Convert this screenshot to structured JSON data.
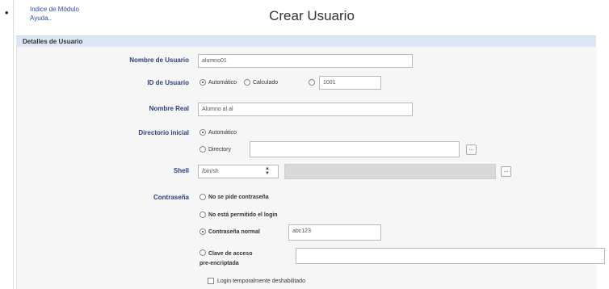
{
  "header": {
    "module_index_link": "Indice de Módulo",
    "help_link": "Ayuda..",
    "title": "Crear Usuario"
  },
  "section": {
    "title": "Detalles de Usuario"
  },
  "form": {
    "username": {
      "label": "Nombre de Usuario",
      "value": "alumno01"
    },
    "user_id": {
      "label": "ID de Usuario",
      "options": [
        "Automático",
        "Calculado",
        ""
      ],
      "selected": "Automático",
      "value": "1001"
    },
    "real_name": {
      "label": "Nombre Real",
      "value": "Alumno al al"
    },
    "home_dir": {
      "label": "Directorio inicial",
      "option_auto": "Automático",
      "option_dir": "Directory",
      "selected": "Automático",
      "dir_value": "",
      "browse_label": "..."
    },
    "shell": {
      "label": "Shell",
      "value": "/bin/sh",
      "browse_label": "..."
    },
    "password": {
      "label": "Contraseña",
      "opt_none": "No se pide contraseña",
      "opt_nologin": "No está permitido el login",
      "opt_normal": "Contraseña normal",
      "normal_value": "abc123",
      "opt_preenc_line1": "Clave de acceso",
      "opt_preenc_line2": "pre-encriptada",
      "preenc_value": "",
      "selected": "Contraseña normal",
      "temp_disabled_label": "Login temporalmente deshabilitado"
    }
  },
  "colors": {
    "section_bg": "#dce6f4",
    "label": "#2d3f7a",
    "link": "#2a4aa8"
  }
}
